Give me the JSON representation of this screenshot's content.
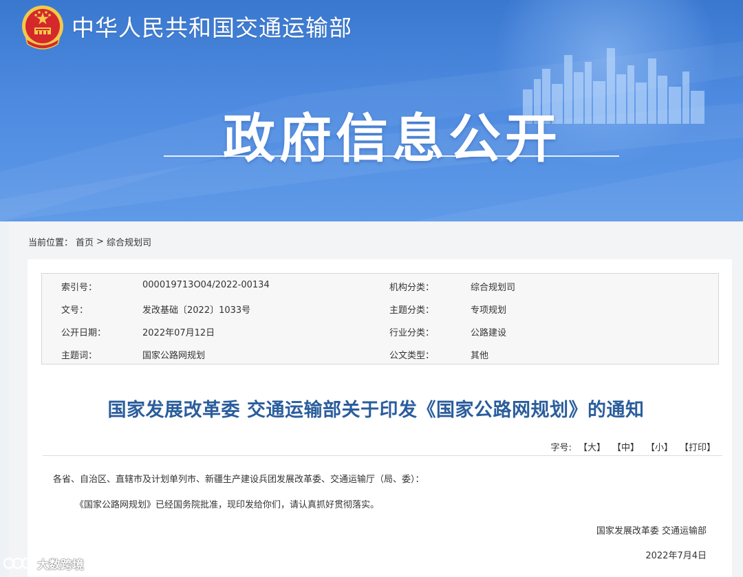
{
  "header": {
    "ministry_name": "中华人民共和国交通运输部",
    "banner_title": "政府信息公开"
  },
  "breadcrumb": {
    "label": "当前位置：",
    "home": "首页",
    "separator": ">",
    "section": "综合规划司"
  },
  "metadata": {
    "rows": [
      {
        "label_left": "索引号：",
        "value_left": "000019713O04/2022-00134",
        "label_right": "机构分类：",
        "value_right": "综合规划司"
      },
      {
        "label_left": "文号：",
        "value_left": "发改基础〔2022〕1033号",
        "label_right": "主题分类：",
        "value_right": "专项规划"
      },
      {
        "label_left": "公开日期：",
        "value_left": "2022年07月12日",
        "label_right": "行业分类：",
        "value_right": "公路建设"
      },
      {
        "label_left": "主题词：",
        "value_left": "国家公路网规划",
        "label_right": "公文类型：",
        "value_right": "其他"
      }
    ]
  },
  "document": {
    "title": "国家发展改革委 交通运输部关于印发《国家公路网规划》的通知",
    "font_size_label": "字号:",
    "font_large": "【大】",
    "font_medium": "【中】",
    "font_small": "【小】",
    "print": "【打印】",
    "paragraph_1": "各省、自治区、直辖市及计划单列市、新疆生产建设兵团发展改革委、交通运输厅（局、委）：",
    "paragraph_2": "《国家公路网规划》已经国务院批准，现印发给你们，请认真抓好贯彻落实。",
    "signature_org": "国家发展改革委 交通运输部",
    "signature_date": "2022年7月4日"
  },
  "watermark": {
    "text": "大数跨境"
  },
  "colors": {
    "banner_blue": "#3a78cf",
    "title_blue": "#2a5d9c",
    "emblem_red": "#d4282c",
    "emblem_gold": "#f3c94a"
  }
}
